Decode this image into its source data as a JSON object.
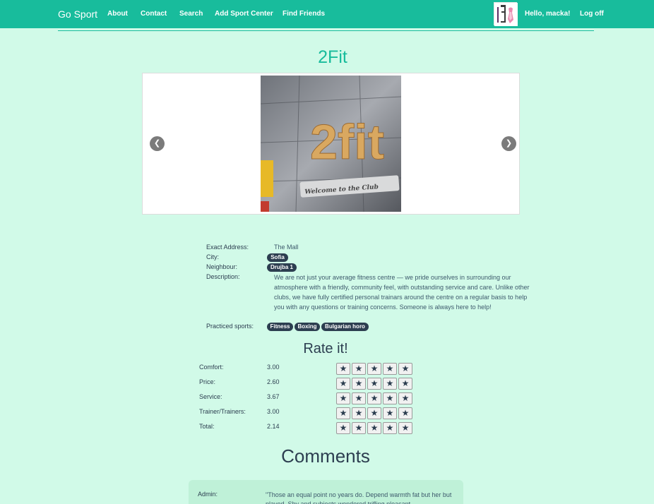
{
  "navbar": {
    "brand": "Go Sport",
    "links": [
      "About",
      "Contact",
      "Search",
      "Add Sport Center",
      "Find Friends"
    ],
    "greeting": "Hello, macka!",
    "logoff": "Log off"
  },
  "center": {
    "name": "2Fit",
    "image_sign": "2fit",
    "image_subtitle": "Welcome to the Club",
    "details": {
      "address_label": "Exact Address:",
      "address": "The Mall",
      "city_label": "City:",
      "city": "Sofia",
      "neighbour_label": "Neighbour:",
      "neighbour": "Drujba 1",
      "description_label": "Description:",
      "description": "We are not just your average fitness centre — we pride ourselves in surrounding our atmosphere with a friendly, community feel, with outstanding service and care. Unlike other clubs, we have fully certified personal trainars around the centre on a regular basis to help you with any questions or training concerns. Someone is always here to help!",
      "sports_label": "Practiced sports:",
      "sports": [
        "Fitness",
        "Boxing",
        "Bulgarian horo"
      ]
    }
  },
  "rating": {
    "heading": "Rate it!",
    "rows": [
      {
        "label": "Comfort:",
        "value": "3.00"
      },
      {
        "label": "Price:",
        "value": "2.60"
      },
      {
        "label": "Service:",
        "value": "3.67"
      },
      {
        "label": "Trainer/Trainers:",
        "value": "3.00"
      },
      {
        "label": "Total:",
        "value": "2.14"
      }
    ],
    "star_glyph": "★"
  },
  "comments": {
    "heading": "Comments",
    "items": [
      {
        "author": "Admin:",
        "text": "\"Those an equal point no years do. Depend warmth fat but her but played. Shy and subjects wondered trifling pleasant"
      }
    ]
  },
  "colors": {
    "navbar": "#18bc9c",
    "background": "#d1fae8",
    "pill": "#2c3e50",
    "title": "#18bc9c"
  },
  "icons": [
    "chevron-left-icon",
    "chevron-right-icon",
    "star-icon"
  ]
}
